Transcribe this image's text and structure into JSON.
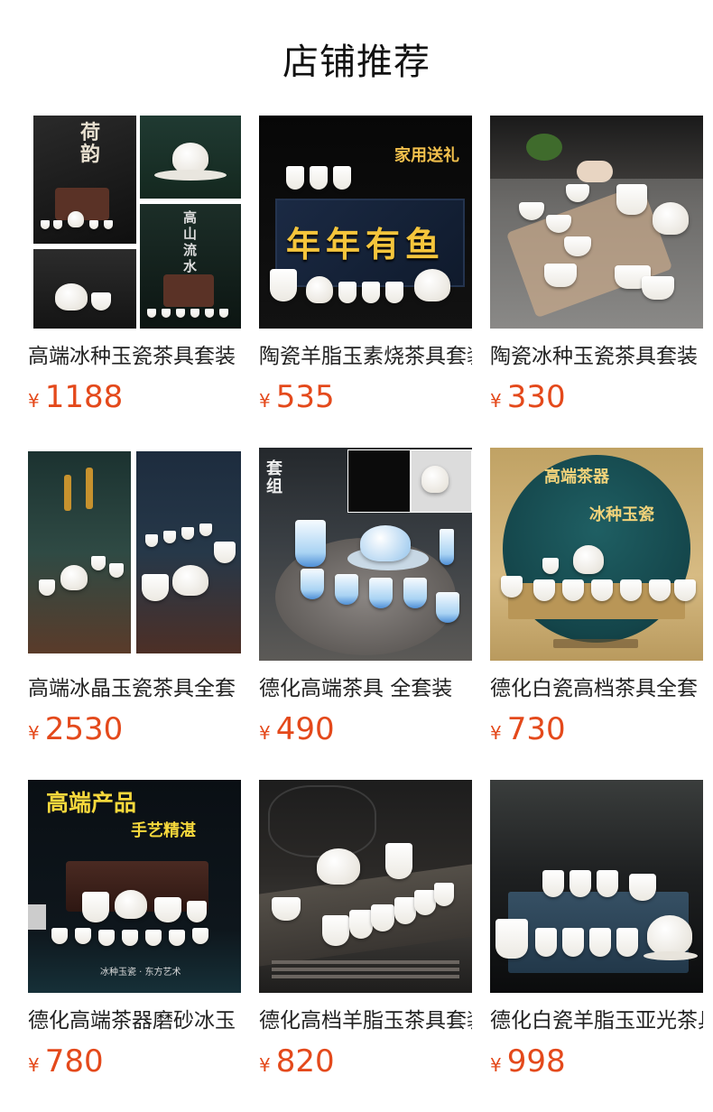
{
  "header": {
    "title": "店铺推荐"
  },
  "currency_symbol": "¥",
  "colors": {
    "price": "#e4491b",
    "title": "#111111",
    "name": "#222222"
  },
  "products": [
    {
      "name": "高端冰种玉瓷茶具套装",
      "price": "1188",
      "image": {
        "overlay": [
          "荷韵",
          "高山流水"
        ]
      }
    },
    {
      "name": "陶瓷羊脂玉素烧茶具套装",
      "price": "535",
      "image": {
        "overlay": [
          "家用送礼",
          "年年有鱼"
        ]
      }
    },
    {
      "name": "陶瓷冰种玉瓷茶具套装",
      "price": "330",
      "image": {
        "overlay": []
      }
    },
    {
      "name": "高端冰晶玉瓷茶具全套",
      "price": "2530",
      "image": {
        "overlay": []
      }
    },
    {
      "name": "德化高端茶具 全套装",
      "price": "490",
      "image": {
        "overlay": [
          "套组"
        ]
      }
    },
    {
      "name": "德化白瓷高档茶具全套",
      "price": "730",
      "image": {
        "overlay": [
          "高端茶器",
          "冰种玉瓷"
        ]
      }
    },
    {
      "name": "德化高端茶器磨砂冰玉",
      "price": "780",
      "image": {
        "overlay": [
          "高端产品",
          "手艺精湛",
          "冰种玉瓷 · 东方艺术"
        ]
      }
    },
    {
      "name": "德化高档羊脂玉茶具套装",
      "price": "820",
      "image": {
        "overlay": []
      }
    },
    {
      "name": "德化白瓷羊脂玉亚光茶具",
      "price": "998",
      "image": {
        "overlay": []
      }
    }
  ]
}
